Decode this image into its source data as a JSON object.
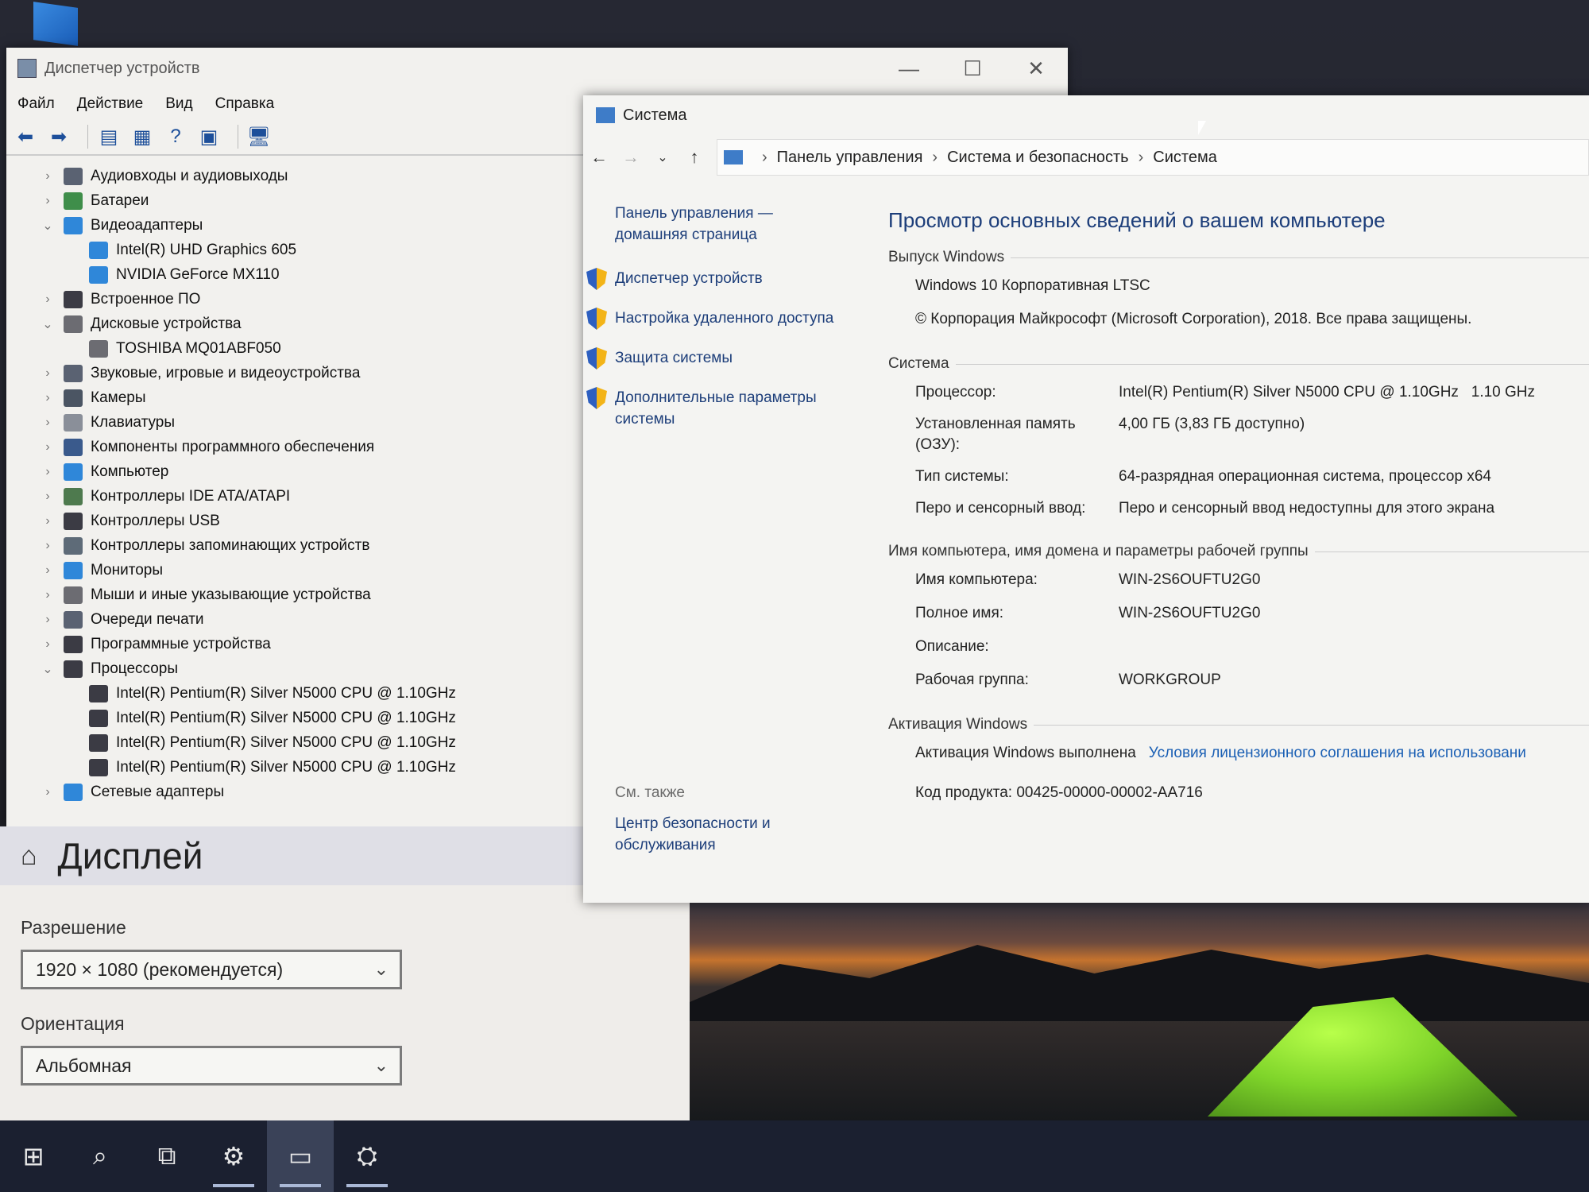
{
  "device_manager": {
    "title": "Диспетчер устройств",
    "menu": [
      "Файл",
      "Действие",
      "Вид",
      "Справка"
    ],
    "tree": [
      {
        "label": "Аудиовходы и аудиовыходы",
        "level": 0,
        "chev": ">",
        "icon": "speaker-icon",
        "color": "#5a6272"
      },
      {
        "label": "Батареи",
        "level": 0,
        "chev": ">",
        "icon": "battery-icon",
        "color": "#3f8e4a"
      },
      {
        "label": "Видеоадаптеры",
        "level": 0,
        "chev": "v",
        "icon": "display-adapter-icon",
        "color": "#2f87d9"
      },
      {
        "label": "Intel(R) UHD Graphics 605",
        "level": 1,
        "icon": "display-adapter-icon",
        "color": "#2f87d9"
      },
      {
        "label": "NVIDIA GeForce MX110",
        "level": 1,
        "icon": "display-adapter-icon",
        "color": "#2f87d9"
      },
      {
        "label": "Встроенное ПО",
        "level": 0,
        "chev": ">",
        "icon": "firmware-icon",
        "color": "#3b3b44"
      },
      {
        "label": "Дисковые устройства",
        "level": 0,
        "chev": "v",
        "icon": "disk-icon",
        "color": "#6c6c72"
      },
      {
        "label": "TOSHIBA MQ01ABF050",
        "level": 1,
        "icon": "disk-icon",
        "color": "#6c6c72"
      },
      {
        "label": "Звуковые, игровые и видеоустройства",
        "level": 0,
        "chev": ">",
        "icon": "sound-icon",
        "color": "#5a6272"
      },
      {
        "label": "Камеры",
        "level": 0,
        "chev": ">",
        "icon": "camera-icon",
        "color": "#4b5563"
      },
      {
        "label": "Клавиатуры",
        "level": 0,
        "chev": ">",
        "icon": "keyboard-icon",
        "color": "#8a8f99"
      },
      {
        "label": "Компоненты программного обеспечения",
        "level": 0,
        "chev": ">",
        "icon": "software-icon",
        "color": "#3a5a8c"
      },
      {
        "label": "Компьютер",
        "level": 0,
        "chev": ">",
        "icon": "computer-icon",
        "color": "#2f87d9"
      },
      {
        "label": "Контроллеры IDE ATA/ATAPI",
        "level": 0,
        "chev": ">",
        "icon": "ide-icon",
        "color": "#4e7a4e"
      },
      {
        "label": "Контроллеры USB",
        "level": 0,
        "chev": ">",
        "icon": "usb-icon",
        "color": "#3b3b44"
      },
      {
        "label": "Контроллеры запоминающих устройств",
        "level": 0,
        "chev": ">",
        "icon": "storage-icon",
        "color": "#5e6b78"
      },
      {
        "label": "Мониторы",
        "level": 0,
        "chev": ">",
        "icon": "monitor-icon",
        "color": "#2f87d9"
      },
      {
        "label": "Мыши и иные указывающие устройства",
        "level": 0,
        "chev": ">",
        "icon": "mouse-icon",
        "color": "#6c6c72"
      },
      {
        "label": "Очереди печати",
        "level": 0,
        "chev": ">",
        "icon": "printer-icon",
        "color": "#5a6272"
      },
      {
        "label": "Программные устройства",
        "level": 0,
        "chev": ">",
        "icon": "software-device-icon",
        "color": "#3b3b44"
      },
      {
        "label": "Процессоры",
        "level": 0,
        "chev": "v",
        "icon": "processor-icon",
        "color": "#3b3b44"
      },
      {
        "label": "Intel(R) Pentium(R) Silver N5000 CPU @ 1.10GHz",
        "level": 1,
        "icon": "processor-icon",
        "color": "#3b3b44"
      },
      {
        "label": "Intel(R) Pentium(R) Silver N5000 CPU @ 1.10GHz",
        "level": 1,
        "icon": "processor-icon",
        "color": "#3b3b44"
      },
      {
        "label": "Intel(R) Pentium(R) Silver N5000 CPU @ 1.10GHz",
        "level": 1,
        "icon": "processor-icon",
        "color": "#3b3b44"
      },
      {
        "label": "Intel(R) Pentium(R) Silver N5000 CPU @ 1.10GHz",
        "level": 1,
        "icon": "processor-icon",
        "color": "#3b3b44"
      },
      {
        "label": "Сетевые адаптеры",
        "level": 0,
        "chev": ">",
        "icon": "network-adapter-icon",
        "color": "#2f87d9"
      }
    ]
  },
  "display_settings": {
    "title": "Дисплей",
    "resolution_label": "Разрешение",
    "resolution_value": "1920 × 1080 (рекомендуется)",
    "orientation_label": "Ориентация",
    "orientation_value": "Альбомная"
  },
  "system_window": {
    "title": "Система",
    "breadcrumb": [
      "Панель управления",
      "Система и безопасность",
      "Система"
    ],
    "sidebar": {
      "home": "Панель управления — домашняя страница",
      "links": [
        "Диспетчер устройств",
        "Настройка удаленного доступа",
        "Защита системы",
        "Дополнительные параметры системы"
      ],
      "see_also": "См. также",
      "security_center": "Центр безопасности и обслуживания"
    },
    "heading": "Просмотр основных сведений о вашем компьютере",
    "windows_edition": {
      "header": "Выпуск Windows",
      "edition": "Windows 10 Корпоративная LTSC",
      "copyright": "© Корпорация Майкрософт (Microsoft Corporation), 2018. Все права защищены."
    },
    "system": {
      "header": "Система",
      "processor_label": "Процессор:",
      "processor_value": "Intel(R) Pentium(R) Silver N5000 CPU @ 1.10GHz   1.10 GHz",
      "memory_label": "Установленная память (ОЗУ):",
      "memory_value": "4,00 ГБ (3,83 ГБ доступно)",
      "type_label": "Тип системы:",
      "type_value": "64-разрядная операционная система, процессор x64",
      "pen_label": "Перо и сенсорный ввод:",
      "pen_value": "Перо и сенсорный ввод недоступны для этого экрана"
    },
    "computer_name": {
      "header": "Имя компьютера, имя домена и параметры рабочей группы",
      "name_label": "Имя компьютера:",
      "name_value": "WIN-2S6OUFTU2G0",
      "full_label": "Полное имя:",
      "full_value": "WIN-2S6OUFTU2G0",
      "desc_label": "Описание:",
      "desc_value": "",
      "group_label": "Рабочая группа:",
      "group_value": "WORKGROUP"
    },
    "activation": {
      "header": "Активация Windows",
      "status": "Активация Windows выполнена",
      "license_link": "Условия лицензионного соглашения на использовани",
      "product_id": "Код продукта: 00425-00000-00002-AA716"
    }
  },
  "taskbar": {
    "items": [
      "start-icon",
      "search-icon",
      "task-view-icon",
      "settings-icon",
      "system-icon",
      "device-manager-icon"
    ]
  }
}
